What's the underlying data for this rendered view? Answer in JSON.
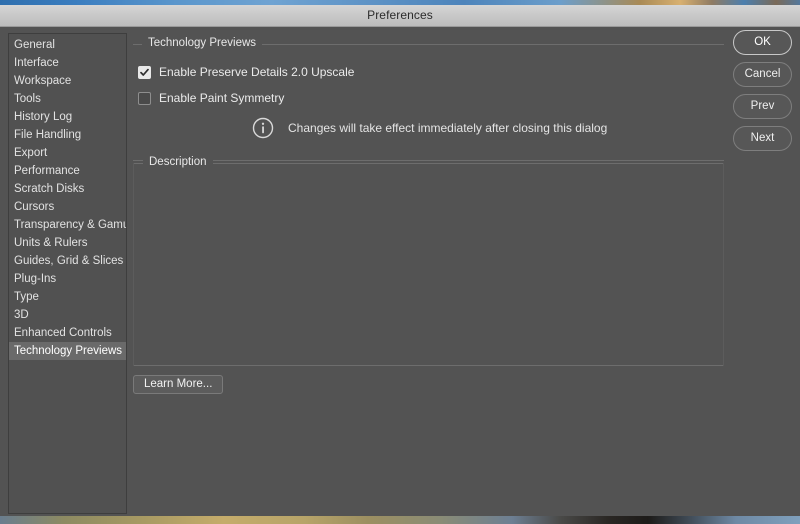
{
  "window": {
    "title": "Preferences"
  },
  "sidebar": {
    "name": "preference-categories",
    "selected": "Technology Previews",
    "items": [
      {
        "label": "General"
      },
      {
        "label": "Interface"
      },
      {
        "label": "Workspace"
      },
      {
        "label": "Tools"
      },
      {
        "label": "History Log"
      },
      {
        "label": "File Handling"
      },
      {
        "label": "Export"
      },
      {
        "label": "Performance"
      },
      {
        "label": "Scratch Disks"
      },
      {
        "label": "Cursors"
      },
      {
        "label": "Transparency & Gamut"
      },
      {
        "label": "Units & Rulers"
      },
      {
        "label": "Guides, Grid & Slices"
      },
      {
        "label": "Plug-Ins"
      },
      {
        "label": "Type"
      },
      {
        "label": "3D"
      },
      {
        "label": "Enhanced Controls"
      },
      {
        "label": "Technology Previews"
      }
    ]
  },
  "actions": {
    "ok": "OK",
    "cancel": "Cancel",
    "prev": "Prev",
    "next": "Next"
  },
  "technology_previews": {
    "group_label": "Technology Previews",
    "checkboxes": [
      {
        "label": "Enable Preserve Details 2.0 Upscale",
        "checked": true
      },
      {
        "label": "Enable Paint Symmetry",
        "checked": false
      }
    ],
    "note": {
      "icon": "info-circle-icon",
      "text": "Changes will take effect immediately after closing this dialog"
    }
  },
  "description": {
    "group_label": "Description",
    "body": ""
  },
  "learn_more": {
    "label": "Learn More..."
  },
  "colors": {
    "dialog_background": "#535353",
    "titlebar_background": "#c8c8c8",
    "selected_row": "#6a6a6a",
    "text": "#e8e8e8",
    "group_rule": "#6d6d6d",
    "default_button_border": "#c8c8c8"
  }
}
